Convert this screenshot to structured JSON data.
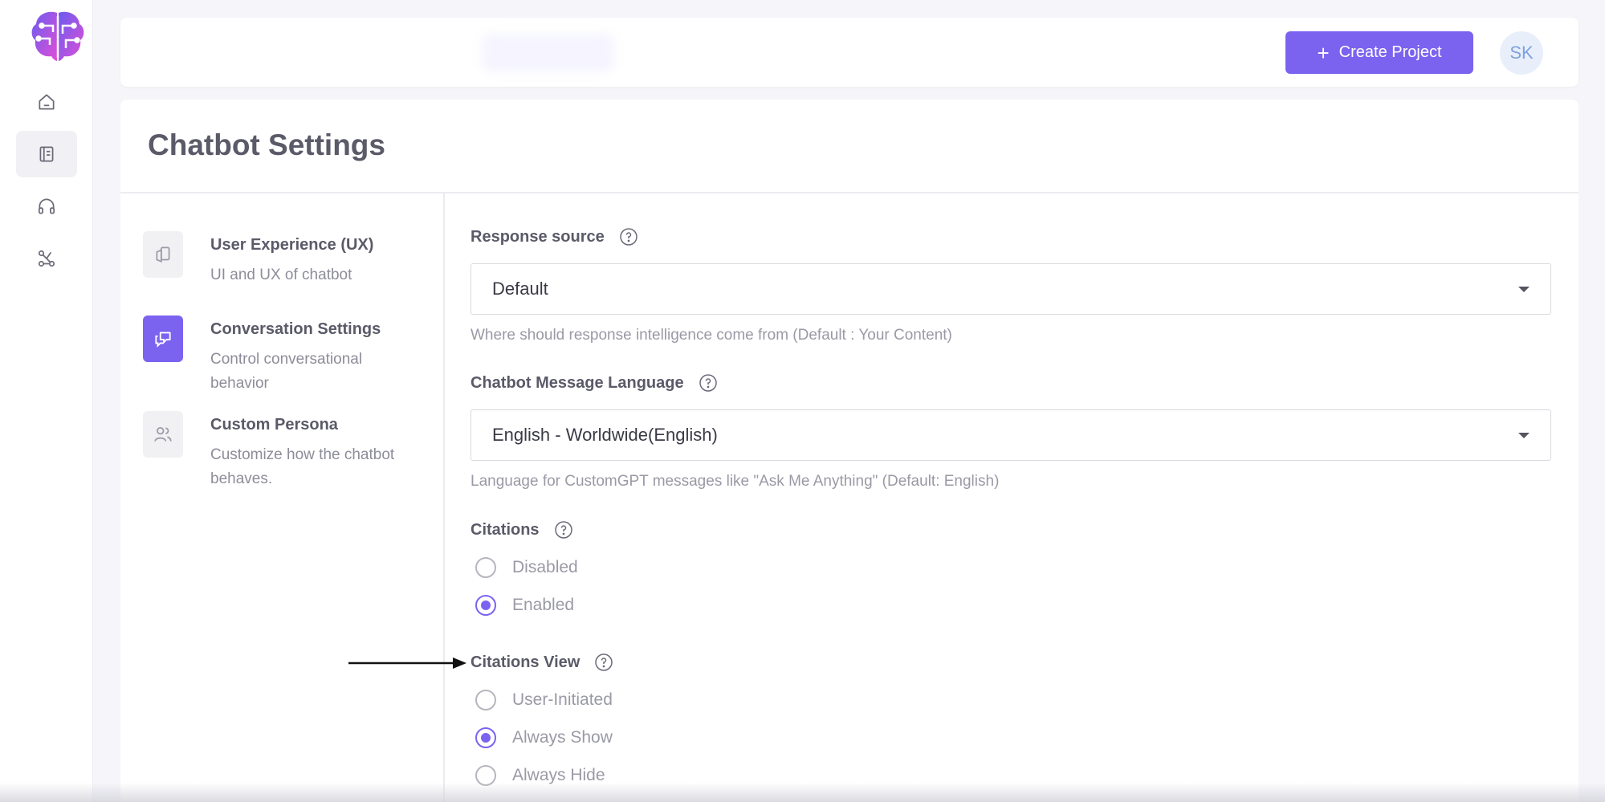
{
  "header": {
    "create_button_label": "Create Project",
    "avatar_initials": "SK"
  },
  "rail": {
    "items": [
      {
        "icon": "home-icon"
      },
      {
        "icon": "book-icon",
        "active": true
      },
      {
        "icon": "headphones-icon"
      },
      {
        "icon": "integrations-icon"
      }
    ]
  },
  "page": {
    "title": "Chatbot Settings"
  },
  "menu": {
    "items": [
      {
        "title": "User Experience (UX)",
        "description": "UI and UX of chatbot",
        "icon": "ux-icon"
      },
      {
        "title": "Conversation Settings",
        "description": "Control conversational behavior",
        "icon": "chat-icon",
        "active": true
      },
      {
        "title": "Custom Persona",
        "description": "Customize how the chatbot behaves.",
        "icon": "persona-icon"
      }
    ]
  },
  "form": {
    "response_source": {
      "label": "Response source",
      "value": "Default",
      "helper": "Where should response intelligence come from (Default : Your Content)"
    },
    "message_language": {
      "label": "Chatbot Message Language",
      "value": "English - Worldwide(English)",
      "helper": "Language for CustomGPT messages like \"Ask Me Anything\" (Default: English)"
    },
    "citations": {
      "label": "Citations",
      "options": [
        "Disabled",
        "Enabled"
      ],
      "selected": "Enabled"
    },
    "citations_view": {
      "label": "Citations View",
      "options": [
        "User-Initiated",
        "Always Show",
        "Always Hide"
      ],
      "selected": "Always Show"
    }
  },
  "colors": {
    "accent": "#7b63f0",
    "background": "#f5f5fa"
  }
}
